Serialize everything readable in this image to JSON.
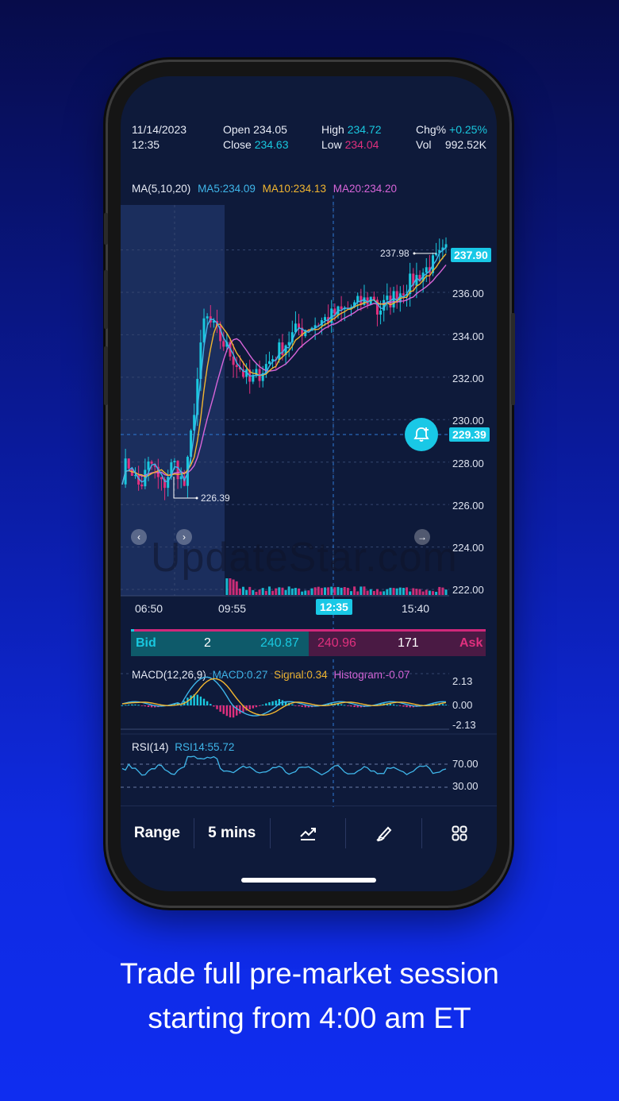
{
  "header": {
    "date": "11/14/2023",
    "time": "12:35",
    "open_label": "Open",
    "open_value": "234.05",
    "close_label": "Close",
    "close_value": "234.63",
    "high_label": "High",
    "high_value": "234.72",
    "low_label": "Low",
    "low_value": "234.04",
    "chg_label": "Chg%",
    "chg_value": "+0.25%",
    "vol_label": "Vol",
    "vol_value": "992.52K"
  },
  "ma": {
    "label": "MA(5,10,20)",
    "ma5": "MA5:234.09",
    "ma10": "MA10:234.13",
    "ma20": "MA20:234.20"
  },
  "price_chart": {
    "y_ticks": [
      "236.00",
      "234.00",
      "232.00",
      "230.00",
      "228.00",
      "226.00",
      "224.00",
      "222.00"
    ],
    "high_marker": "237.98",
    "low_marker": "226.39",
    "last_price_tag": "237.90",
    "crosshair_price_tag": "229.39",
    "x_ticks": [
      "06:50",
      "09:55",
      "15:40"
    ],
    "crosshair_time": "12:35",
    "watermark": "UpdateStar.com"
  },
  "bid_ask": {
    "bid_label": "Bid",
    "bid_size": "2",
    "bid_price": "240.87",
    "ask_price": "240.96",
    "ask_size": "171",
    "ask_label": "Ask"
  },
  "macd": {
    "label": "MACD(12,26,9)",
    "macd": "MACD:0.27",
    "signal": "Signal:0.34",
    "histogram": "Histogram:-0.07",
    "ticks": [
      "2.13",
      "0.00",
      "-2.13"
    ]
  },
  "rsi": {
    "label": "RSI(14)",
    "value": "RSI14:55.72",
    "ticks": [
      "70.00",
      "30.00"
    ]
  },
  "toolbar": {
    "range_label": "Range",
    "interval_label": "5 mins",
    "indicator_icon": "chart-line-icon",
    "draw_icon": "pen-icon",
    "grid_icon": "grid-icon"
  },
  "caption": {
    "line1": "Trade full pre-market session",
    "line2": "starting from 4:00 am ET"
  },
  "colors": {
    "cyan": "#19c8df",
    "pink": "#e0307e",
    "ma10": "#f2b630",
    "ma20": "#d865d9"
  }
}
